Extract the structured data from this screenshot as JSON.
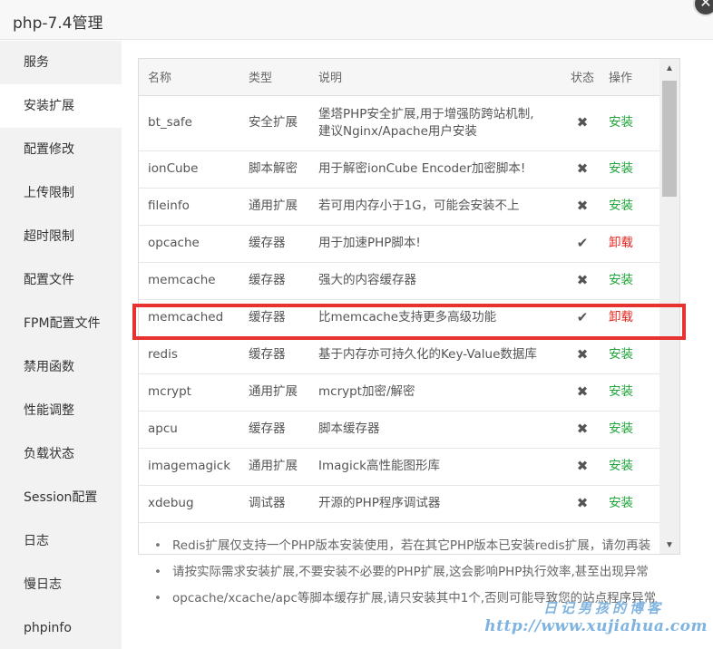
{
  "window": {
    "title": "php-7.4管理",
    "close_glyph": "✕"
  },
  "sidebar": {
    "items": [
      {
        "label": "服务"
      },
      {
        "label": "安装扩展",
        "active": true
      },
      {
        "label": "配置修改"
      },
      {
        "label": "上传限制"
      },
      {
        "label": "超时限制"
      },
      {
        "label": "配置文件"
      },
      {
        "label": "FPM配置文件"
      },
      {
        "label": "禁用函数"
      },
      {
        "label": "性能调整"
      },
      {
        "label": "负载状态"
      },
      {
        "label": "Session配置"
      },
      {
        "label": "日志"
      },
      {
        "label": "慢日志"
      },
      {
        "label": "phpinfo"
      }
    ]
  },
  "table": {
    "headers": {
      "name": "名称",
      "type": "类型",
      "desc": "说明",
      "status": "状态",
      "action": "操作"
    },
    "rows": [
      {
        "name": "bt_safe",
        "type": "安全扩展",
        "desc": "堡塔PHP安全扩展,用于增强防跨站机制,",
        "desc2": "建议Nginx/Apache用户安装",
        "status": "✖",
        "action": "安装"
      },
      {
        "name": "ionCube",
        "type": "脚本解密",
        "desc": "用于解密ionCube Encoder加密脚本!",
        "status": "✖",
        "action": "安装"
      },
      {
        "name": "fileinfo",
        "type": "通用扩展",
        "desc": "若可用内存小于1G，可能会安装不上",
        "status": "✖",
        "action": "安装"
      },
      {
        "name": "opcache",
        "type": "缓存器",
        "desc": "用于加速PHP脚本!",
        "status": "✔",
        "action": "卸载"
      },
      {
        "name": "memcache",
        "type": "缓存器",
        "desc": "强大的内容缓存器",
        "status": "✖",
        "action": "安装"
      },
      {
        "name": "memcached",
        "type": "缓存器",
        "desc": "比memcache支持更多高级功能",
        "status": "✔",
        "action": "卸载"
      },
      {
        "name": "redis",
        "type": "缓存器",
        "desc": "基于内存亦可持久化的Key-Value数据库",
        "status": "✖",
        "action": "安装"
      },
      {
        "name": "mcrypt",
        "type": "通用扩展",
        "desc": "mcrypt加密/解密",
        "status": "✖",
        "action": "安装"
      },
      {
        "name": "apcu",
        "type": "缓存器",
        "desc": "脚本缓存器",
        "status": "✖",
        "action": "安装"
      },
      {
        "name": "imagemagick",
        "type": "通用扩展",
        "desc": "Imagick高性能图形库",
        "status": "✖",
        "action": "安装"
      },
      {
        "name": "xdebug",
        "type": "调试器",
        "desc": "开源的PHP程序调试器",
        "status": "✖",
        "action": "安装"
      }
    ]
  },
  "notes": [
    "Redis扩展仅支持一个PHP版本安装使用，若在其它PHP版本已安装redis扩展，请勿再装",
    "请按实际需求安装扩展,不要安装不必要的PHP扩展,这会影响PHP执行效率,甚至出现异常",
    "opcache/xcache/apc等脚本缓存扩展,请只安装其中1个,否则可能导致您的站点程序异常"
  ],
  "watermark": {
    "line1": "日记男孩的博客",
    "line2": "http://www.xujiahua.com"
  },
  "colors": {
    "install": "#20a53a",
    "uninstall": "#e0241c",
    "highlight": "#e8322f"
  },
  "icons": {
    "scroll_up": "▲",
    "scroll_down": "▼"
  }
}
